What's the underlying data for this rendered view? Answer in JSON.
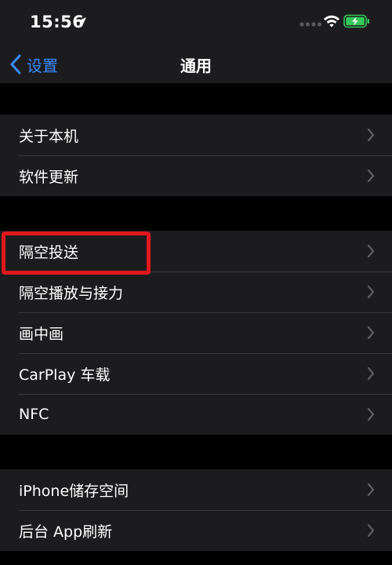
{
  "status_bar": {
    "time": "15:56",
    "icons": [
      "location-arrow-icon",
      "signal-dots-icon",
      "wifi-icon",
      "battery-charging-icon"
    ],
    "battery_color": "#34c759"
  },
  "nav": {
    "back_label": "设置",
    "title": "通用",
    "accent_color": "#3b8cff"
  },
  "groups": [
    {
      "items": [
        {
          "label": "关于本机"
        },
        {
          "label": "软件更新"
        }
      ]
    },
    {
      "items": [
        {
          "label": "隔空投送"
        },
        {
          "label": "隔空播放与接力"
        },
        {
          "label": "画中画"
        },
        {
          "label": "CarPlay 车载"
        },
        {
          "label": "NFC"
        }
      ]
    },
    {
      "items": [
        {
          "label": "iPhone储存空间"
        },
        {
          "label": "后台 App刷新"
        }
      ]
    }
  ],
  "highlight": {
    "target": "隔空投送",
    "color": "#e3171e"
  }
}
